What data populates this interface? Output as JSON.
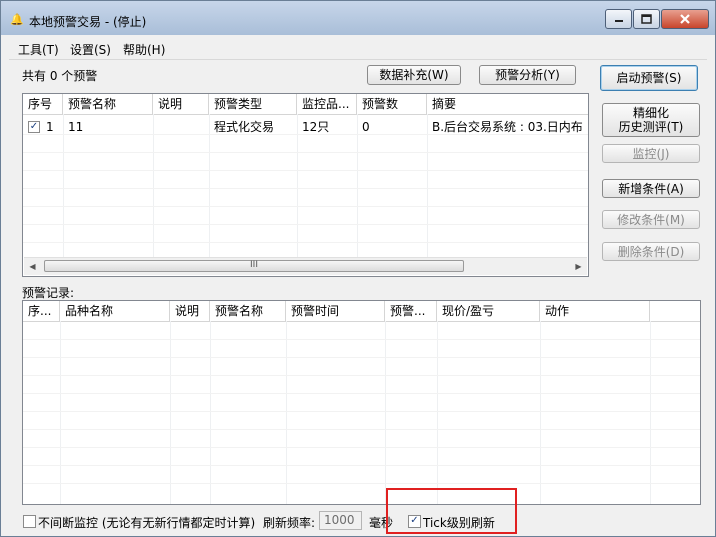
{
  "window": {
    "title": "本地预警交易 - (停止)",
    "icon": "bell-icon"
  },
  "menu": [
    "工具(T)",
    "设置(S)",
    "帮助(H)"
  ],
  "count_label": "共有 0 个预警",
  "top_buttons": {
    "data_supplement": "数据补充(W)",
    "alert_analysis": "预警分析(Y)"
  },
  "right_buttons": {
    "start": "启动预警(S)",
    "refine_line1": "精细化",
    "refine_line2": "历史测评(T)",
    "monitor": "监控(J)",
    "add_condition": "新增条件(A)",
    "modify_condition": "修改条件(M)",
    "delete_condition": "删除条件(D)"
  },
  "alerts_table": {
    "columns": [
      "序号",
      "预警名称",
      "说明",
      "预警类型",
      "监控品...",
      "预警数",
      "摘要"
    ],
    "rows": [
      {
        "checked": true,
        "index": "1",
        "name": "11",
        "desc": "",
        "type": "程式化交易",
        "monitor": "12只",
        "count": "0",
        "summary": "B.后台交易系统 : 03.日内布"
      }
    ],
    "scroll_thumb": "III"
  },
  "records_label": "预警记录:",
  "records_table": {
    "columns": [
      "序...",
      "品种名称",
      "说明",
      "预警名称",
      "预警时间",
      "预警...",
      "现价/盈亏",
      "动作"
    ]
  },
  "footer": {
    "continuous_label": "不间断监控 (无论有无新行情都定时计算)",
    "refresh_label": "刷新频率:",
    "refresh_value": "1000",
    "unit": "毫秒",
    "tick_label": "Tick级别刷新",
    "continuous_checked": false,
    "tick_checked": true
  }
}
